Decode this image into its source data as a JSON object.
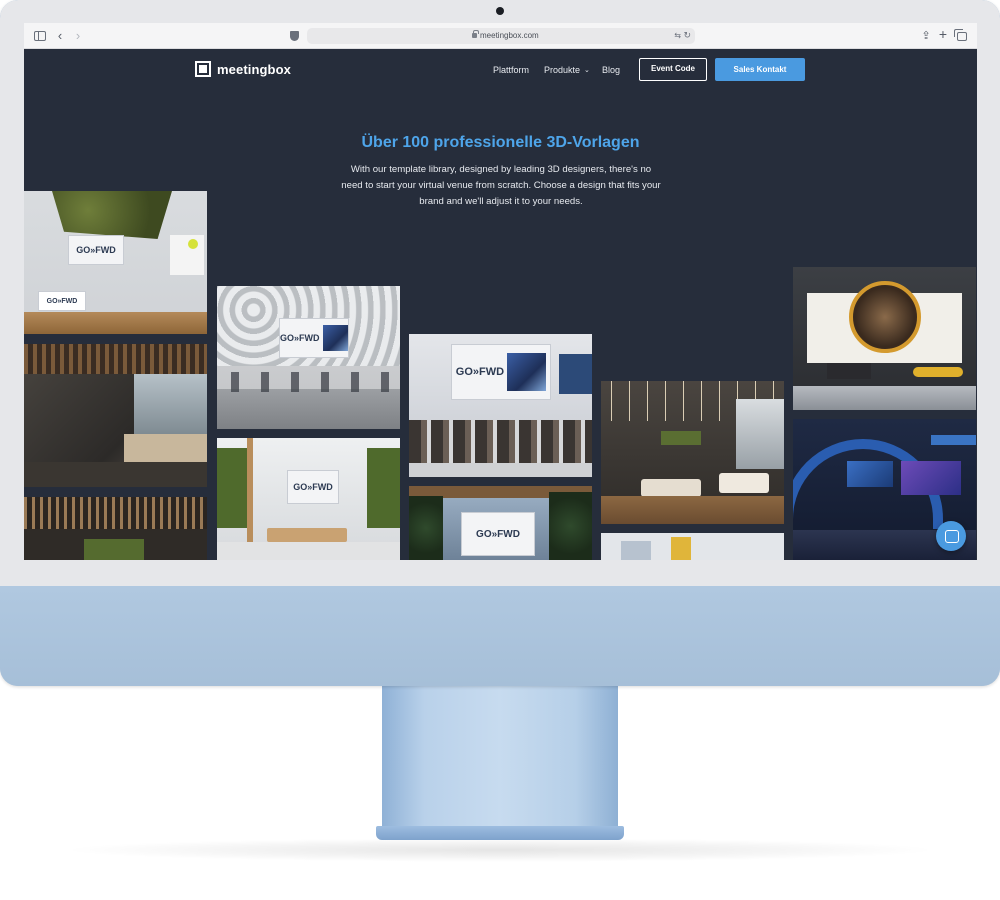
{
  "browser": {
    "url": "meetingbox.com",
    "back_glyph": "‹",
    "forward_glyph": "›",
    "reload_glyph": "↻",
    "translate_glyph": "⇆",
    "share_glyph": "⇪",
    "new_tab_glyph": "+"
  },
  "nav": {
    "logo": "meetingbox",
    "links": [
      "Plattform",
      "Produkte",
      "Blog"
    ],
    "produkte_chevron": "⌄",
    "event_code": "Event Code",
    "sales_contact": "Sales Kontakt"
  },
  "hero": {
    "title": "Über 100 professionelle 3D-Vorlagen",
    "text": "With our template library, designed by leading 3D designers, there's no need to start your virtual venue from scratch. Choose a design that fits your brand and we'll adjust it to your needs."
  },
  "gallery": {
    "brand_text": "GO»FWD",
    "tiles": [
      "Green wall expo booth",
      "Cafe lounge with wooden slats",
      "Wooden slat lounge",
      "Auditorium with hexagon wall",
      "Meeting room with green wall",
      "Conference hall",
      "Outdoor stage with trees",
      "Lounge with pendant lights",
      "Exhibition hall",
      "Round screen booth",
      "Manufacturing expo booth"
    ]
  },
  "colors": {
    "page_bg": "#262d3b",
    "accent": "#4ea5ea",
    "sales_button": "#4a9ae0",
    "monitor": "#a9c2dc"
  },
  "icons": [
    "sidebar-icon",
    "back-icon",
    "forward-icon",
    "shield-icon",
    "lock-icon",
    "translate-icon",
    "reload-icon",
    "share-icon",
    "new-tab-icon",
    "tabs-icon",
    "chat-icon"
  ]
}
